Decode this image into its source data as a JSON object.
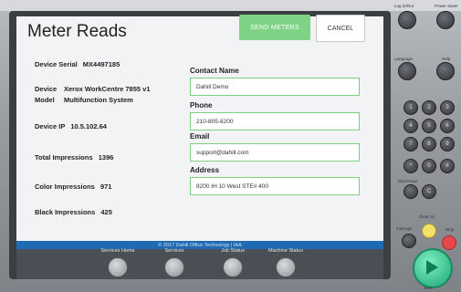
{
  "title": "Meter Reads",
  "buttons": {
    "send": "SEND METERS",
    "cancel": "CANCEL"
  },
  "device": {
    "serial_label": "Device Serial",
    "serial_value": "MX4497185",
    "model_label_1": "Device",
    "model_value_1": "Xerox WorkCentre 7855 v1",
    "model_label_2": "Model",
    "model_value_2": "Multifunction System",
    "ip_label": "Device IP",
    "ip_value": "10.5.102.64",
    "total_label": "Total Impressions",
    "total_value": "1396",
    "color_label": "Color Impressions",
    "color_value": "971",
    "black_label": "Black Impressions",
    "black_value": "425"
  },
  "form": {
    "contact_label": "Contact Name",
    "contact_value": "Dahill Demo",
    "phone_label": "Phone",
    "phone_value": "210-805-8200",
    "email_label": "Email",
    "email_value": "support@dahill.com",
    "address_label": "Address",
    "address_value": "8200 IH 10 West STE# 400"
  },
  "footer": "© 2017 Dahill Office Technology | IAA",
  "hardware_buttons": [
    "Services Home",
    "Services",
    "Job Status",
    "Machine Status"
  ],
  "panel_labels": {
    "login": "Log In/Out",
    "power": "Power Saver",
    "language": "Language",
    "help": "Help",
    "clear_all": "Clear All",
    "interrupt": "Interrupt",
    "stop": "Stop",
    "start": "Start",
    "dial_pause": "Dial Pause"
  },
  "keypad": [
    "1",
    "2",
    "3",
    "4",
    "5",
    "6",
    "7",
    "8",
    "9",
    "*",
    "0",
    "#",
    "C"
  ],
  "colors": {
    "accent": "#7ed387",
    "footer": "#1f6bb3",
    "start": "#2dbb88"
  }
}
